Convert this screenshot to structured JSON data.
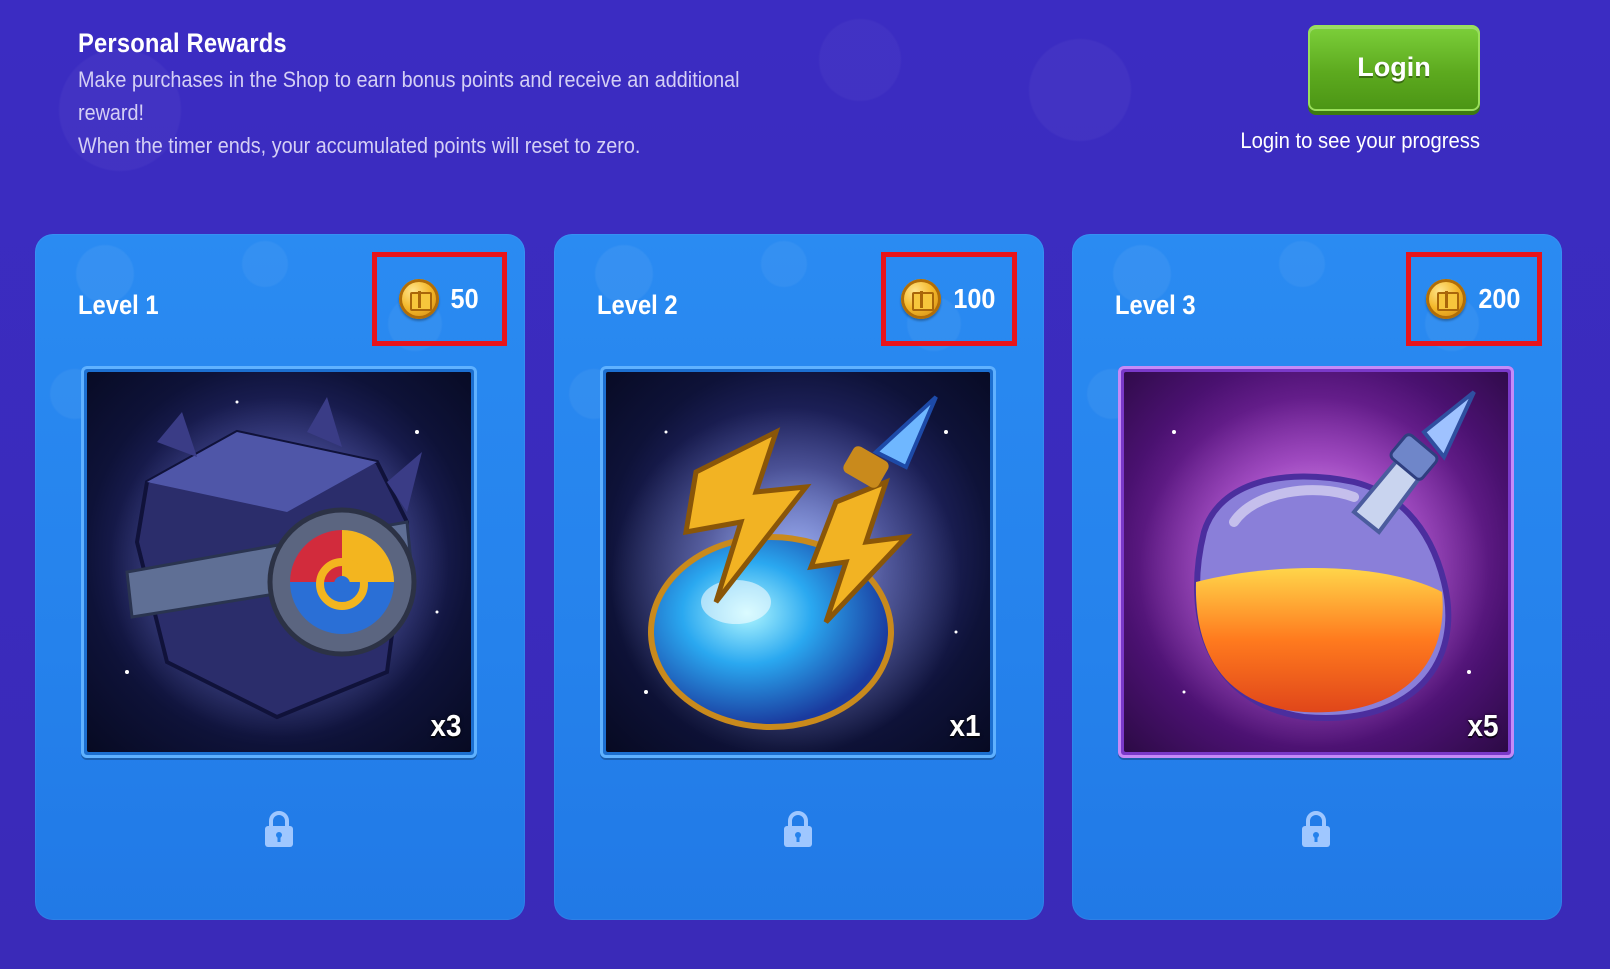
{
  "header": {
    "title": "Personal Rewards",
    "description_line1": "Make purchases in the Shop to earn bonus points and receive an additional reward!",
    "description_line2": "When the timer ends, your accumulated points will reset to zero."
  },
  "login": {
    "button_label": "Login",
    "hint": "Login to see your progress"
  },
  "colors": {
    "background": "#3a2bbf",
    "card": "#2582ec",
    "login_button": "#5daa1f",
    "highlight_box": "#e8141b"
  },
  "levels": [
    {
      "label": "Level 1",
      "points": "50",
      "quantity": "x3",
      "reward_icon": "dark-cube-chest-icon",
      "locked": true
    },
    {
      "label": "Level 2",
      "points": "100",
      "quantity": "x1",
      "reward_icon": "lightning-potion-icon",
      "locked": true
    },
    {
      "label": "Level 3",
      "points": "200",
      "quantity": "x5",
      "reward_icon": "orange-elixir-icon",
      "locked": true
    }
  ],
  "icons": {
    "points": "gift-coin-icon",
    "locked": "padlock-icon"
  }
}
